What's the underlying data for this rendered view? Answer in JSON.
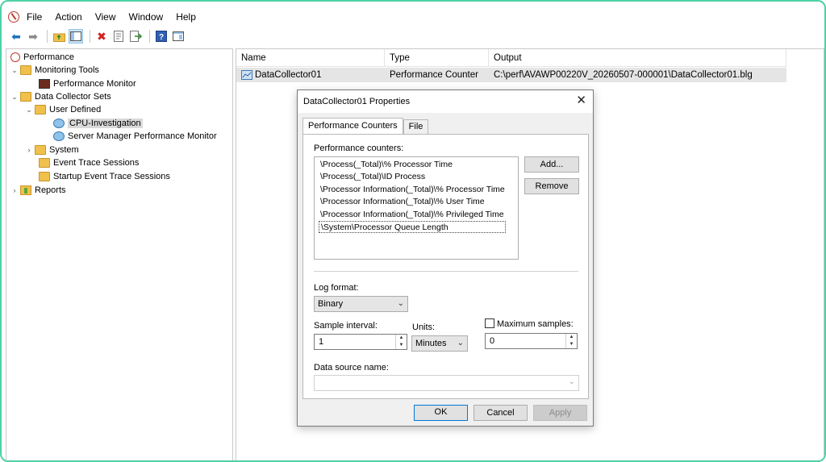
{
  "menu": {
    "items": [
      "File",
      "Action",
      "View",
      "Window",
      "Help"
    ]
  },
  "toolbar": {
    "icons": [
      "back-arrow-icon",
      "forward-arrow-icon",
      "up-folder-icon",
      "show-hide-tree-icon",
      "delete-icon",
      "properties-icon",
      "export-icon",
      "help-icon",
      "console-icon"
    ]
  },
  "tree": {
    "root": "Performance",
    "monitoring_tools": "Monitoring Tools",
    "performance_monitor": "Performance Monitor",
    "data_collector_sets": "Data Collector Sets",
    "user_defined": "User Defined",
    "cpu_investigation": "CPU-Investigation",
    "server_manager": "Server Manager Performance Monitor",
    "system": "System",
    "event_trace": "Event Trace Sessions",
    "startup_trace": "Startup Event Trace Sessions",
    "reports": "Reports"
  },
  "list": {
    "columns": [
      "Name",
      "Type",
      "Output"
    ],
    "rows": [
      {
        "name": "DataCollector01",
        "type": "Performance Counter",
        "output": "C:\\perf\\AVAWP00220V_20260507-000001\\DataCollector01.blg"
      }
    ]
  },
  "dialog": {
    "title": "DataCollector01 Properties",
    "tabs": [
      "Performance Counters",
      "File"
    ],
    "counters_label": "Performance counters:",
    "counters": [
      "\\Process(_Total)\\% Processor Time",
      "\\Process(_Total)\\ID Process",
      "\\Processor Information(_Total)\\% Processor Time",
      "\\Processor Information(_Total)\\% User Time",
      "\\Processor Information(_Total)\\% Privileged Time",
      "\\System\\Processor Queue Length"
    ],
    "add_button": "Add...",
    "remove_button": "Remove",
    "log_format_label": "Log format:",
    "log_format_value": "Binary",
    "sample_interval_label": "Sample interval:",
    "sample_interval_value": "1",
    "units_label": "Units:",
    "units_value": "Minutes",
    "max_samples_label": "Maximum samples:",
    "max_samples_value": "0",
    "data_source_label": "Data source name:",
    "data_source_value": "",
    "ok_button": "OK",
    "cancel_button": "Cancel",
    "apply_button": "Apply"
  },
  "colors": {
    "frame_border": "#4fd1a6",
    "selection": "#d9d9d9",
    "default_button": "#0078d7"
  }
}
